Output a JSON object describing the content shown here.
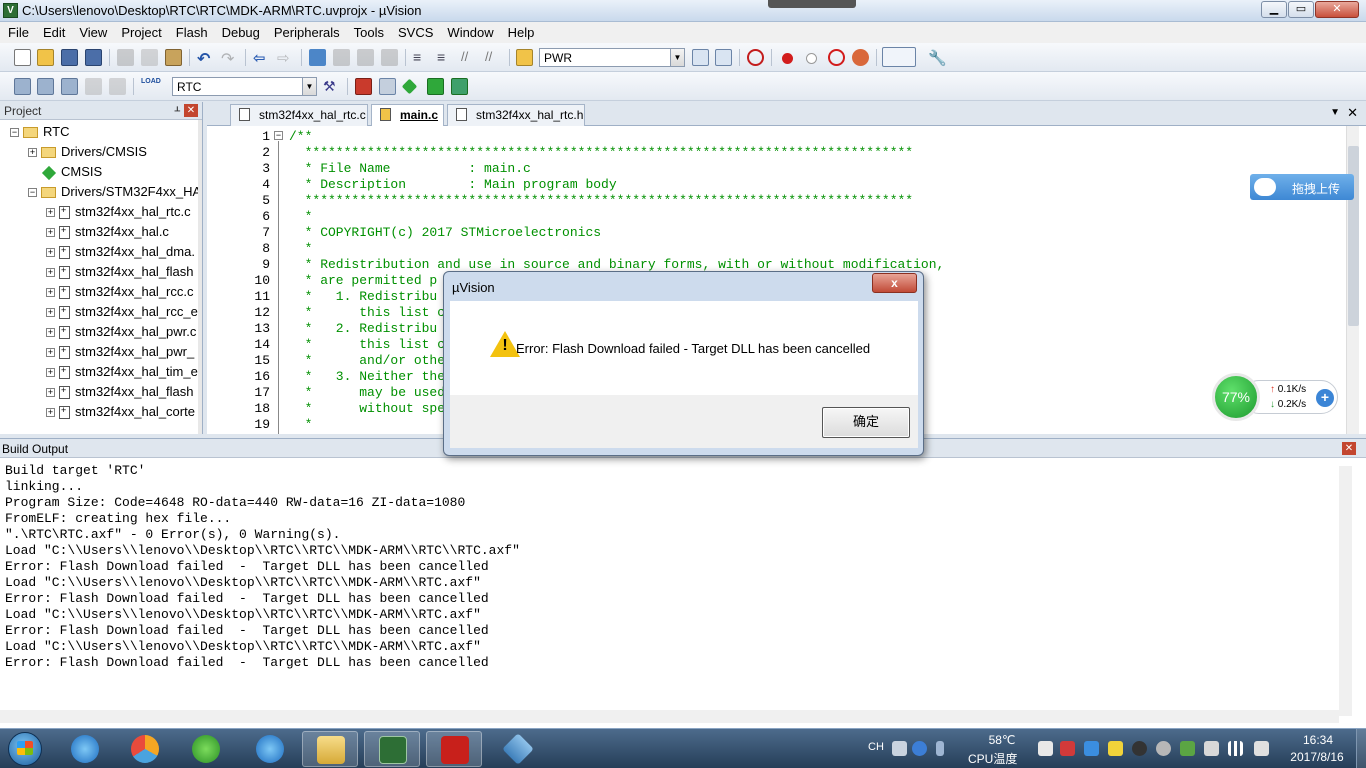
{
  "window": {
    "title": "C:\\Users\\lenovo\\Desktop\\RTC\\RTC\\MDK-ARM\\RTC.uvprojx - µVision",
    "app_icon": "V"
  },
  "menu": [
    "File",
    "Edit",
    "View",
    "Project",
    "Flash",
    "Debug",
    "Peripherals",
    "Tools",
    "SVCS",
    "Window",
    "Help"
  ],
  "toolbar1": {
    "find_combo_value": "PWR"
  },
  "toolbar2": {
    "target_combo_value": "RTC",
    "load_label": "LOAD"
  },
  "project": {
    "header": "Project",
    "tree": [
      {
        "label": "RTC",
        "type": "root",
        "expander": "−"
      },
      {
        "label": "Drivers/CMSIS",
        "type": "folder",
        "expander": "+"
      },
      {
        "label": "CMSIS",
        "type": "component",
        "expander": ""
      },
      {
        "label": "Drivers/STM32F4xx_HA",
        "type": "folder",
        "expander": "−"
      },
      {
        "label": "stm32f4xx_hal_rtc.c",
        "type": "file",
        "expander": "+"
      },
      {
        "label": "stm32f4xx_hal.c",
        "type": "file",
        "expander": "+"
      },
      {
        "label": "stm32f4xx_hal_dma.",
        "type": "file",
        "expander": "+"
      },
      {
        "label": "stm32f4xx_hal_flash",
        "type": "file",
        "expander": "+"
      },
      {
        "label": "stm32f4xx_hal_rcc.c",
        "type": "file",
        "expander": "+"
      },
      {
        "label": "stm32f4xx_hal_rcc_e",
        "type": "file",
        "expander": "+"
      },
      {
        "label": "stm32f4xx_hal_pwr.c",
        "type": "file",
        "expander": "+"
      },
      {
        "label": "stm32f4xx_hal_pwr_",
        "type": "file",
        "expander": "+"
      },
      {
        "label": "stm32f4xx_hal_tim_e",
        "type": "file",
        "expander": "+"
      },
      {
        "label": "stm32f4xx_hal_flash",
        "type": "file",
        "expander": "+"
      },
      {
        "label": "stm32f4xx_hal_corte",
        "type": "file",
        "expander": "+"
      }
    ]
  },
  "editor": {
    "tabs": [
      {
        "label": "stm32f4xx_hal_rtc.c",
        "active": false
      },
      {
        "label": "main.c",
        "active": true
      },
      {
        "label": "stm32f4xx_hal_rtc.h",
        "active": false
      }
    ],
    "lines": [
      {
        "n": "1",
        "text": "/**"
      },
      {
        "n": "2",
        "text": "  ******************************************************************************"
      },
      {
        "n": "3",
        "text": "  * File Name          : main.c"
      },
      {
        "n": "4",
        "text": "  * Description        : Main program body"
      },
      {
        "n": "5",
        "text": "  ******************************************************************************"
      },
      {
        "n": "6",
        "text": "  *"
      },
      {
        "n": "7",
        "text": "  * COPYRIGHT(c) 2017 STMicroelectronics"
      },
      {
        "n": "8",
        "text": "  *"
      },
      {
        "n": "9",
        "text": "  * Redistribution and use in source and binary forms, with or without modification,"
      },
      {
        "n": "10",
        "text": "  * are permitted p"
      },
      {
        "n": "11",
        "text": "  *   1. Redistribu"
      },
      {
        "n": "12",
        "text": "  *      this list c                                                         "
      },
      {
        "n": "13",
        "text": "  *   2. Redistribu                                                        e,"
      },
      {
        "n": "14",
        "text": "  *      this list c                                                       on"
      },
      {
        "n": "15",
        "text": "  *      and/or othe"
      },
      {
        "n": "16",
        "text": "  *   3. Neither the                                                       s"
      },
      {
        "n": "17",
        "text": "  *      may be used"
      },
      {
        "n": "18",
        "text": "  *      without spe"
      },
      {
        "n": "19",
        "text": "  *"
      }
    ]
  },
  "build_output": {
    "header": "Build Output",
    "lines": [
      "Build target 'RTC'",
      "linking...",
      "Program Size: Code=4648 RO-data=440 RW-data=16 ZI-data=1080",
      "FromELF: creating hex file...",
      "\".\\RTC\\RTC.axf\" - 0 Error(s), 0 Warning(s).",
      "Load \"C:\\\\Users\\\\lenovo\\\\Desktop\\\\RTC\\\\RTC\\\\MDK-ARM\\\\RTC\\\\RTC.axf\"",
      "Error: Flash Download failed  -  Target DLL has been cancelled",
      "Load \"C:\\\\Users\\\\lenovo\\\\Desktop\\\\RTC\\\\RTC\\\\MDK-ARM\\\\RTC.axf\"",
      "Error: Flash Download failed  -  Target DLL has been cancelled",
      "Load \"C:\\\\Users\\\\lenovo\\\\Desktop\\\\RTC\\\\RTC\\\\MDK-ARM\\\\RTC.axf\"",
      "Error: Flash Download failed  -  Target DLL has been cancelled",
      "Load \"C:\\\\Users\\\\lenovo\\\\Desktop\\\\RTC\\\\RTC\\\\MDK-ARM\\\\RTC.axf\"",
      "Error: Flash Download failed  -  Target DLL has been cancelled"
    ]
  },
  "dialog": {
    "title": "µVision",
    "message": "Error: Flash Download failed  -  Target DLL has been cancelled",
    "ok_label": "确定",
    "close_glyph": "x"
  },
  "widgets": {
    "upload_label": "拖拽上传",
    "speed_percent": "77%",
    "upload_speed": "0.1K/s",
    "download_speed": "0.2K/s"
  },
  "taskbar": {
    "lang": "CH",
    "temperature": "58℃",
    "temperature_label": "CPU温度",
    "time": "16:34",
    "date": "2017/8/16"
  },
  "colors": {
    "comment_green": "#009000",
    "error_red": "#c3462f",
    "taskbar_blue": "#263e58"
  }
}
